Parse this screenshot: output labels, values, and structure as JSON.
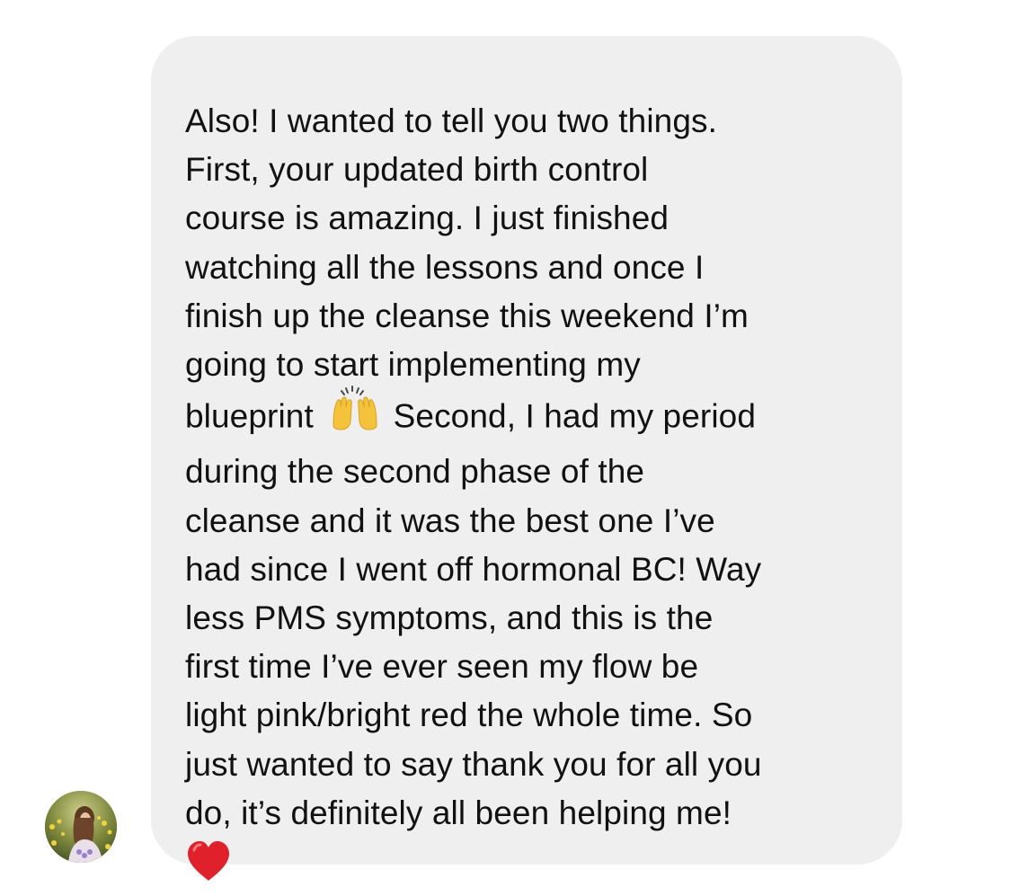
{
  "message": {
    "lines": [
      "Also! I wanted to tell you two things.",
      "First, your updated birth control",
      "course is amazing. I just finished",
      "watching all the lessons and once I",
      "finish up the cleanse this weekend I’m",
      "going to start implementing my",
      "blueprint",
      "Second, I had my period",
      "during the second phase of the",
      "cleanse and it was the best one I’ve",
      "had since I went off hormonal BC! Way",
      "less PMS symptoms, and this is the",
      "first time I’ve ever seen my flow be",
      "light pink/bright red the whole time. So",
      "just wanted to say thank you for all you",
      "do, it’s definitely all been helping me!"
    ],
    "emoji_inline": "raising-hands-icon",
    "emoji_end": "red-heart-icon"
  },
  "colors": {
    "bubble": "#efefef",
    "text": "#111111",
    "heart": "#e0202a",
    "hands": "#f5c33b"
  }
}
